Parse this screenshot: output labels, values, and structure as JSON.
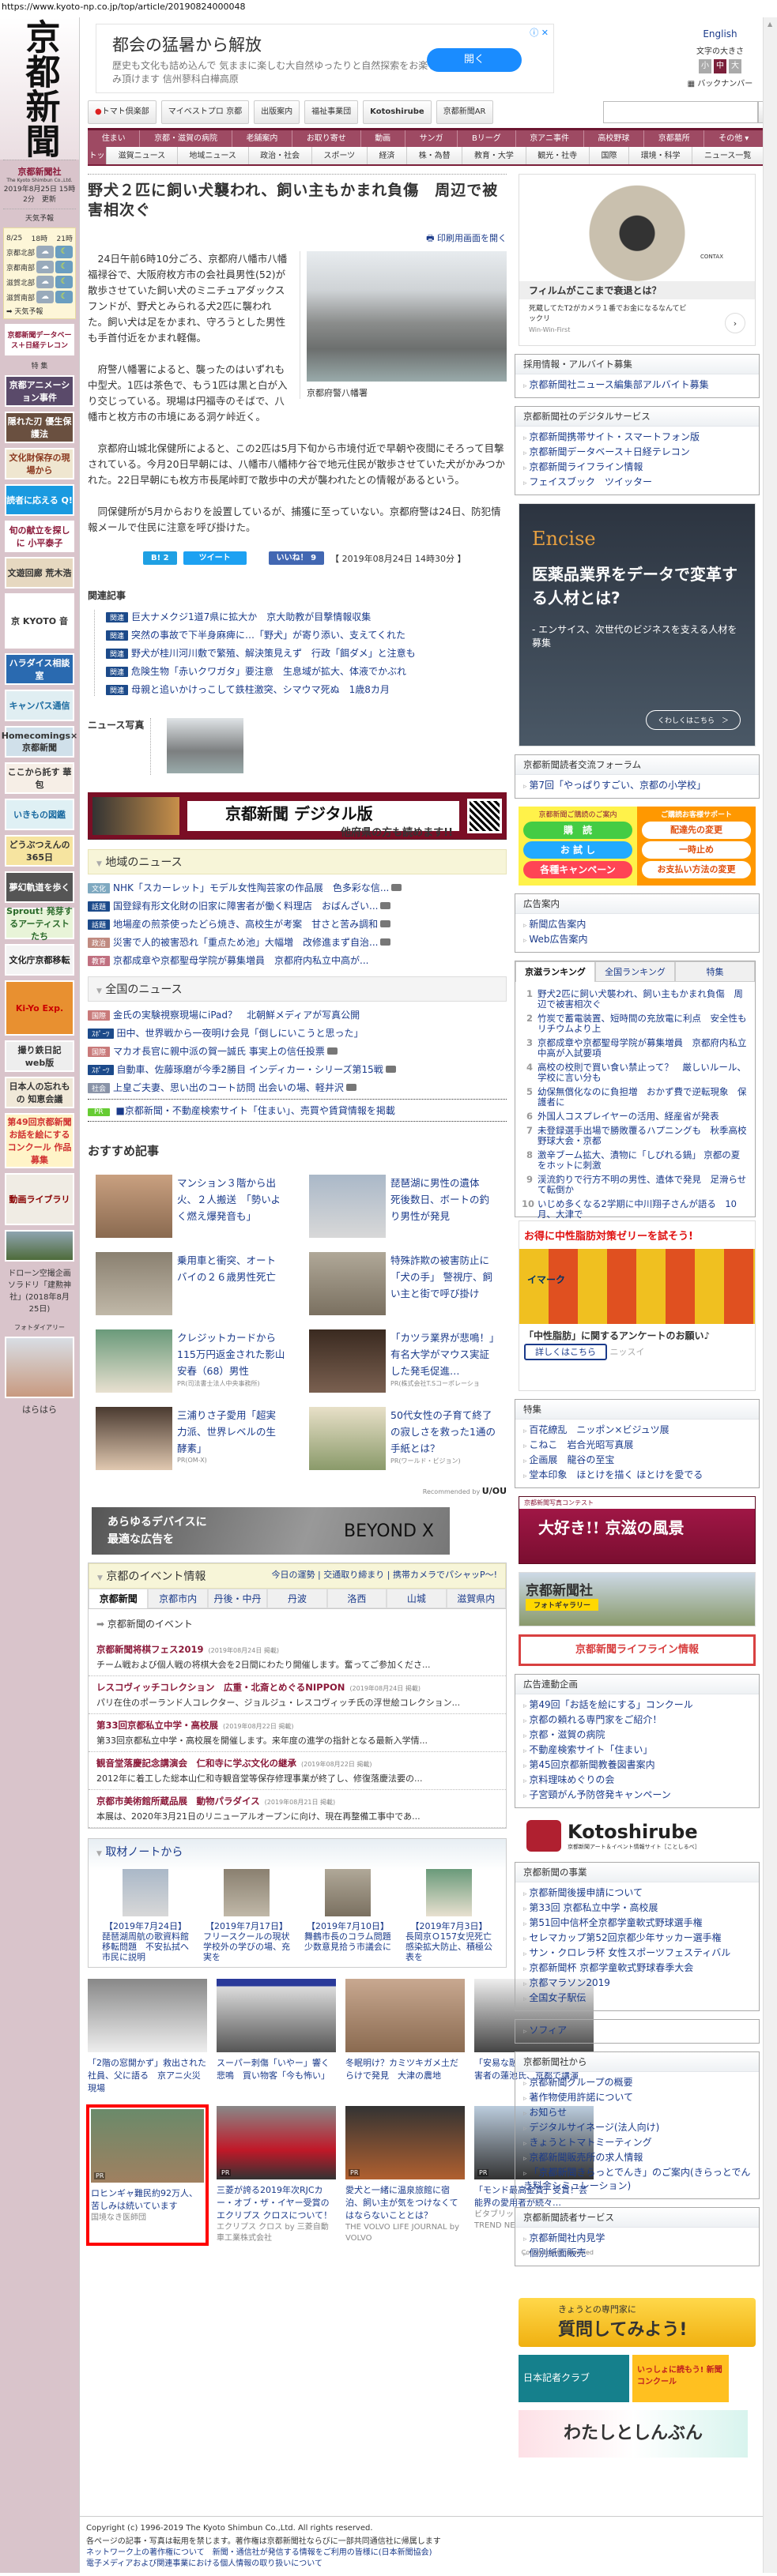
{
  "url": "https://www.kyoto-np.co.jp/top/article/20190824000048",
  "logo": "京都新聞",
  "left": {
    "company": "京都新聞社",
    "company_en": "The Kyoto Shimbun Co.,Ltd.",
    "updated": "2019年8月25日 15時2分　更新",
    "weather_title": "天気予報",
    "weather_head": [
      "8/25",
      "18時",
      "21時"
    ],
    "weather_rows": [
      "京都北部",
      "京都南部",
      "滋賀北部",
      "滋賀南部"
    ],
    "weather_link": "天気予報",
    "telecom": "京都新聞データベース＋日経テレコン",
    "special": "特 集",
    "banners": [
      "京都アニメーション事件",
      "隠れた刃 優生保護法",
      "文化財保存の現場から",
      "読者に応える Q!",
      "旬の献立を探しに 小平泰子",
      "文遊回廊 荒木浩",
      "京 KYOTO 音",
      "ハラダイス相談室",
      "キャンパス通信",
      "Homecomings×京都新聞",
      "ここから託す 華包",
      "いきもの図鑑",
      "どうぶつえんの365日",
      "夢幻軌道を歩く",
      "Sprout! 発芽するアーティストたち",
      "文化庁京都移転",
      "Ki-Yo Exp.",
      "撮り鉄日記 web版",
      "日本人の忘れもの 知恵会議",
      "第49回京都新聞 お話を絵にするコンクール 作品募集",
      "動画ライブラリ"
    ],
    "drone_caption": "ドローン空撮企画ソラドリ「建勲神社」(2018年8月25日)",
    "photo_diary": "フォトダイアリー",
    "photo_caption": "はらはら"
  },
  "top_ad": {
    "title": "都会の猛暑から解放",
    "text": "歴史も文化も詰め込んで 気ままに楽しむ大自然ゆったりと自然探索をお楽しみ頂けます 信州蓼科白樺高原",
    "button": "開く"
  },
  "header_right": {
    "english": "English",
    "font_size": "文字の大きさ",
    "sizes": [
      "小",
      "中",
      "大"
    ],
    "backnumber": "バックナンバー"
  },
  "buttons": [
    "トマト倶楽部",
    "マイベストプロ 京都",
    "出版案内",
    "福祉事業団",
    "Kotoshirube",
    "京都新聞AR"
  ],
  "search": {
    "button": "検 索",
    "placeholder": ""
  },
  "nav1": [
    "住まい",
    "京都・滋賀の病院",
    "老舗案内",
    "お取り寄せ",
    "動画",
    "サンガ",
    "Bリーグ",
    "京アニ事件",
    "高校野球",
    "京都墓所",
    "その他 ▾"
  ],
  "nav2": [
    "トップ",
    "滋賀ニュース",
    "地域ニュース",
    "政治・社会",
    "スポーツ",
    "経済",
    "株・為替",
    "教育・大学",
    "観光・社寺",
    "国際",
    "環境・科学",
    "ニュース一覧"
  ],
  "article": {
    "title": "野犬２匹に飼い犬襲われ、飼い主もかまれ負傷　周辺で被害相次ぐ",
    "print": "印刷用画面を開く",
    "photo_caption": "京都府警八幡署",
    "paragraphs": [
      "24日午前6時10分ごろ、京都府八幡市八幡福禄谷で、大阪府枚方市の会社員男性(52)が散歩させていた飼い犬のミニチュアダックスフンドが、野犬とみられる犬2匹に襲われた。飼い犬は足をかまれ、守ろうとした男性も手首付近をかまれ軽傷。",
      "府警八幡署によると、襲ったのはいずれも中型犬。1匹は茶色で、もう1匹は黒と白が入り交じっている。現場は円福寺のそばで、八幡市と枚方市の市境にある洞ケ峠近く。",
      "京都府山城北保健所によると、この2匹は5月下旬から市境付近で早朝や夜間にそろって目撃されている。今月20日早朝には、八幡市八幡柿ケ谷で地元住民が散歩させていた犬がかみつかれた。22日早朝にも枚方市長尾峠町で散歩中の犬が襲われたとの情報があるという。",
      "同保健所が5月からおりを設置しているが、捕獲に至っていない。京都府警は24日、防犯情報メールで住民に注意を呼び掛けた。"
    ],
    "hatena": "B! 2",
    "tweet": "ツイート",
    "like": "いいね！ 9",
    "date": "【 2019年08月24日 14時30分 】"
  },
  "related": {
    "heading": "関連記事",
    "tag": "関連",
    "items": [
      "巨大ナメクジ1道7県に拡大か　京大助教が目撃情報収集",
      "突然の事故で下半身麻痺に…「野犬」が寄り添い、支えてくれた",
      "野犬が桂川河川敷で繁殖、解決策見えず　行政「餌ダメ」と注意も",
      "危険生物「赤いクワガタ」要注意　生息域が拡大、体液でかぶれ",
      "母親と追いかけっこして鉄柱激突、シマウマ死ぬ　1歳8カ月"
    ]
  },
  "news_photo": "ニュース写真",
  "digital": {
    "title": "京都新聞 デジタル版",
    "sub": "他府県の方も読めます!!"
  },
  "local": {
    "heading": "地域のニュース",
    "items": [
      {
        "tag": "文化",
        "color": "#7fa9c0",
        "text": "NHK「スカーレット」モデル女性陶芸家の作品展　色多彩な信..."
      },
      {
        "tag": "話題",
        "color": "#1c4a8a",
        "text": "国登録有形文化財の旧家に障害者が働く料理店　おばんざい..."
      },
      {
        "tag": "話題",
        "color": "#1c4a8a",
        "text": "地場産の煎茶使ったどら焼き、高校生が考案　甘さと苦み調和"
      },
      {
        "tag": "政治",
        "color": "#c08a80",
        "text": "災害で人的被害恐れ「重点ため池」大幅増　改修進まず自治..."
      },
      {
        "tag": "教育",
        "color": "#c07080",
        "text": "京都成章や京都聖母学院が募集増員　京都府内私立中高が..."
      }
    ]
  },
  "national": {
    "heading": "全国のニュース",
    "items": [
      {
        "tag": "国際",
        "color": "#c97a7a",
        "text": "金氏の実験視察現場にiPad？　北朝鮮メディアが写真公開"
      },
      {
        "tag": "ｽﾎﾟｰﾂ",
        "color": "#1c4a8a",
        "text": "田中、世界戦から一夜明け会見「倒しにいこうと思った」"
      },
      {
        "tag": "国際",
        "color": "#c97a7a",
        "text": "マカオ長官に親中派の賀一誠氏 事実上の信任投票"
      },
      {
        "tag": "ｽﾎﾟｰﾂ",
        "color": "#1c4a8a",
        "text": "自動車、佐藤琢磨が今季2勝目 インディカー・シリーズ第15戦"
      },
      {
        "tag": "社会",
        "color": "#8a94a8",
        "text": "上皇ご夫妻、思い出のコート訪問 出会いの場、軽井沢"
      }
    ],
    "pr_tag": "PR",
    "pr": "■京都新聞・不動産検索サイト「住まい」、売買や賃貸情報を掲載"
  },
  "recommended": {
    "heading": "おすすめ記事",
    "items": [
      {
        "title": "マンション３階から出火、２人搬送　「勢いよく燃え爆発音も」",
        "src": ""
      },
      {
        "title": "琵琶湖に男性の遺体　死後数日、ボートの釣り男性が発見",
        "src": ""
      },
      {
        "title": "乗用車と衝突、オートバイの２６歳男性死亡",
        "src": ""
      },
      {
        "title": "特殊詐欺の被害防止に「犬の手」 警視庁、飼い主と街で呼び掛け",
        "src": ""
      },
      {
        "title": "クレジットカードから115万円返金された影山安春（68）男性",
        "src": "PR(司法書士法人中央事務所)"
      },
      {
        "title": "「カツラ業界が悲鳴！」有名大学がマウス実証した発毛促進…",
        "src": "PR(株式会社T.Sコーポレーショ"
      },
      {
        "title": "三浦りさ子愛用「超実力派、世界レベルの生酵素」",
        "src": "PR(OM-X)"
      },
      {
        "title": "50代女性の子育て終了の寂しさを救った1通の手紙とは？",
        "src": "PR(ワールド・ビジョン)"
      }
    ],
    "by": "Recommended by",
    "brand": "U/OU"
  },
  "beyond": {
    "text1": "あらゆるデバイスに",
    "text2": "最適な広告を",
    "brand": "BEYOND X"
  },
  "events": {
    "heading": "京都のイベント情報",
    "links": "今日の運勢 | 交通取り締まり | 携帯カメラでパシャッP〜!",
    "tabs": [
      "京都新聞",
      "京都市内",
      "丹後・中丹",
      "丹波",
      "洛西",
      "山城",
      "滋賀県内"
    ],
    "sub": "京都新聞のイベント",
    "items": [
      {
        "title": "京都新聞将棋フェス2019",
        "date": "(2019年08月24日 掲載)",
        "text": "チーム戦および個人戦の将棋大会を2日間にわたり開催します。奮ってご参加くださ..."
      },
      {
        "title": "レスコヴィッチコレクション　広重・北斎とめぐるNIPPON",
        "date": "(2019年08月24日 掲載)",
        "text": "パリ在住のポーランド人コレクター、ジョルジュ・レスコヴィッチ氏の浮世絵コレクション..."
      },
      {
        "title": "第33回京都私立中学・高校展",
        "date": "(2019年08月22日 掲載)",
        "text": "第33回京都私立中学・高校展を開催します。来年度の進学の指針となる最新入学情..."
      },
      {
        "title": "観音堂落慶記念講演会　仁和寺に学ぶ文化の継承",
        "date": "(2019年08月22日 掲載)",
        "text": "2012年に着工した総本山仁和寺観音堂等保存修理事業が終了し、修復落慶法要の..."
      },
      {
        "title": "京都市美術館所蔵品展　動物パラダイス",
        "date": "(2019年08月21日 掲載)",
        "text": "本展は、2020年3月21日のリニューアルオープンに向け、現在再整備工事中であ..."
      }
    ]
  },
  "notes": {
    "heading": "取材ノートから",
    "items": [
      {
        "date": "【2019年7月24日】",
        "text": "琵琶湖周航の歌資料館移転問題　不安払拭へ市民に説明"
      },
      {
        "date": "【2019年7月17日】",
        "text": "フリースクールの現状　学校外の学びの場、充実を"
      },
      {
        "date": "【2019年7月10日】",
        "text": "舞鶴市長のコラム問題　少数意見拾う市議会に"
      },
      {
        "date": "【2019年7月3日】",
        "text": "長岡京Ｏ157女児死亡　感染拡大防止、積極公表を"
      }
    ]
  },
  "bottom_grid": [
    {
      "title": "「2階の窓開かず」救出された社員、父に語る　京アニ火災現場",
      "src": "",
      "pr": false
    },
    {
      "title": "スーパー刺傷「いやー」響く悲鳴　買い物客「今も怖い」",
      "src": "",
      "pr": false
    },
    {
      "title": "冬眠明け？カミツキガメ土だらけで発見　大津の農地",
      "src": "",
      "pr": false
    },
    {
      "title": "「安易な融和策は…」拉致被害者の蓮池氏、京都で講演",
      "src": "",
      "pr": false
    },
    {
      "title": "ロヒンギャ難民約92万人、苦しみは続いています",
      "src": "国境なき医師団",
      "pr": true
    },
    {
      "title": "三菱が誇る2019年次RJCカー・オブ・ザ・イヤー受賞のエクリプス クロスについて！",
      "src": "エクリプス クロス by 三菱自動車工業株式会社",
      "pr": true
    },
    {
      "title": "愛犬と一緒に温泉旅館に宿泊、飼い主が気をつけなくてはならないこととは？",
      "src": "THE VOLVO LIFE JOURNAL by VOLVO",
      "pr": true
    },
    {
      "title": "「モンド最高金賞」受賞！芸能界の愛用者が続々…",
      "src": "ビタブリッドジャパン on TREND NEWS",
      "pr": true
    }
  ],
  "pr_label": "PR",
  "contentmatic": "Contentmatic powered",
  "side": {
    "ad1": {
      "title": "フィルムがここまで衰退とは？",
      "text": "死蔵してたT2がカメラ１番でお金になるなんてビックリ",
      "src": "Win-Win-First",
      "brand": "CONTAX"
    },
    "recruit": {
      "h": "採用情報・アルバイト募集",
      "items": [
        "京都新聞社ニュース編集部アルバイト募集"
      ]
    },
    "digital": {
      "h": "京都新聞社のデジタルサービス",
      "items": [
        "京都新聞携帯サイト・スマートフォン版",
        "京都新聞データベース＋日経テレコン",
        "京都新聞ライフライン情報",
        "フェイスブック　ツイッター"
      ]
    },
    "encise": {
      "brand": "Encise",
      "title": "医薬品業界をデータで変革する人材とは?",
      "sub": "- エンサイス、次世代のビジネスを支える人材を募集",
      "btn": "くわしくはこちら　＞"
    },
    "forum": {
      "h": "京都新聞読者交流フォーラム",
      "items": [
        "第7回「やっぱりすごい、京都の小学校」"
      ]
    },
    "sub": {
      "left_h": "京都新聞ご購読のご案内",
      "left": [
        "購　読",
        "お 試 し",
        "各種キャンペーン"
      ],
      "right_h": "ご購読お客様サポート",
      "right": [
        "配達先の変更",
        "一時止め",
        "お支払い方法の変更"
      ]
    },
    "adinfo": {
      "h": "広告案内",
      "items": [
        "新聞広告案内",
        "Web広告案内"
      ]
    },
    "ranking": {
      "tabs": [
        "京滋ランキング",
        "全国ランキング",
        "特集"
      ],
      "items": [
        "野犬2匹に飼い犬襲われ、飼い主もかまれ負傷　周辺で被害相次ぐ",
        "竹炭で蓄電装置、短時間の充放電に利点　安全性もリチウムより上",
        "京都成章や京都聖母学院が募集増員　京都府内私立中高が入試要項",
        "高校の校則で買い食い禁止って？　厳しいルール、学校に言い分も",
        "幼保無償化なのに負担増　おかず費で逆転現象　保護者に",
        "外国人コスプレイヤーの活用、経産省が発表",
        "未登録選手出場で勝敗覆るハプニングも　秋季高校野球大会・京都",
        "激辛ブーム拡大、漬物に「しびれる鍋」 京都の夏をホットに刺激",
        "渓流釣りで行方不明の男性、遺体で発見　足滑らせて転倒か",
        "いじめ多くなる2学期に中川翔子さんが語る　10月、大津で"
      ]
    },
    "ad2": {
      "title": "お得に中性脂肪対策ゼリーを試そう!",
      "text": "「中性脂肪」に関するアンケートのお願い♪",
      "btn": "詳しくはこちら",
      "src": "ニッスイ",
      "product": "イマーク"
    },
    "tokushu": {
      "h": "特集",
      "items": [
        "百花繚乱　ニッポン×ビジュツ展",
        "こねこ　岩合光昭写真展",
        "企画展　龍谷の至宝",
        "堂本印象　ほとけを描く ほとけを愛でる"
      ]
    },
    "contest": {
      "small": "京都新聞写真コンテスト",
      "big": "大好き!! 京滋の風景"
    },
    "gallery": {
      "name": "京都新聞社",
      "sub": "フォトギャラリー"
    },
    "lifeline": "京都新聞ライフライン情報",
    "adlink": {
      "h": "広告連動企画",
      "items": [
        "第49回「お話を絵にする」コンクール",
        "京都の頼れる専門家をご紹介！",
        "京都・滋賀の病院",
        "不動産検索サイト「住まい」",
        "第45回京都新聞教養図書案内",
        "京料理味めぐりの会",
        "子宮頸がん予防啓発キャンペーン"
      ]
    },
    "kotoshirube": {
      "name": "Kotoshirube",
      "sub": "京都新聞アート＆イベント情報サイト［ことしるべ］"
    },
    "business": {
      "h": "京都新聞の事業",
      "items": [
        "京都新聞後援申請について",
        "第33回 京都私立中学・高校展",
        "第51回中信杯全京都学童軟式野球選手権",
        "セレマカップ第52回京都少年サッカー選手権",
        "サン・クロレラ杯 女性スポーツフェスティバル",
        "京都新聞杯 京都学童軟式野球春季大会",
        "京都マラソン2019",
        "全国女子駅伝"
      ]
    },
    "sophia": {
      "items": [
        "ソフィア"
      ]
    },
    "from": {
      "h": "京都新聞社から",
      "items": [
        "京都新聞グループの概要",
        "著作物使用許諾について",
        "お知らせ",
        "デジタルサイネージ(法人向け)",
        "きょうとトマトミーティング",
        "京都新聞販売所の求人情報",
        "「京都新聞きらっとでんき」のご案内(きらっとでんき料金シミュレーション)"
      ]
    },
    "reader": {
      "h": "京都新聞読者サービス",
      "items": [
        "京都新聞社内見学",
        "個別紙面販売"
      ]
    },
    "ask": {
      "small": "きょうとの専門家に",
      "big": "質問してみよう!"
    },
    "pressclub": "日本記者クラブ",
    "concours": "いっしょに読もう! 新聞コンクール",
    "watashi": "わたしとしんぶん"
  },
  "footer": {
    "copyright": "Copyright (c) 1996-2019 The Kyoto Shimbun Co.,Ltd. All rights reserved.",
    "notice": "各ページの記事・写真は転用を禁じます。著作権は京都新聞社ならびに一部共同通信社に帰属します",
    "links": [
      "ネットワーク上の著作権について",
      "新聞・通信社が発信する情報をご利用の皆様に(日本新聞協会)",
      "電子メディアおよび関連事業における個人情報の取り扱いについて"
    ]
  }
}
